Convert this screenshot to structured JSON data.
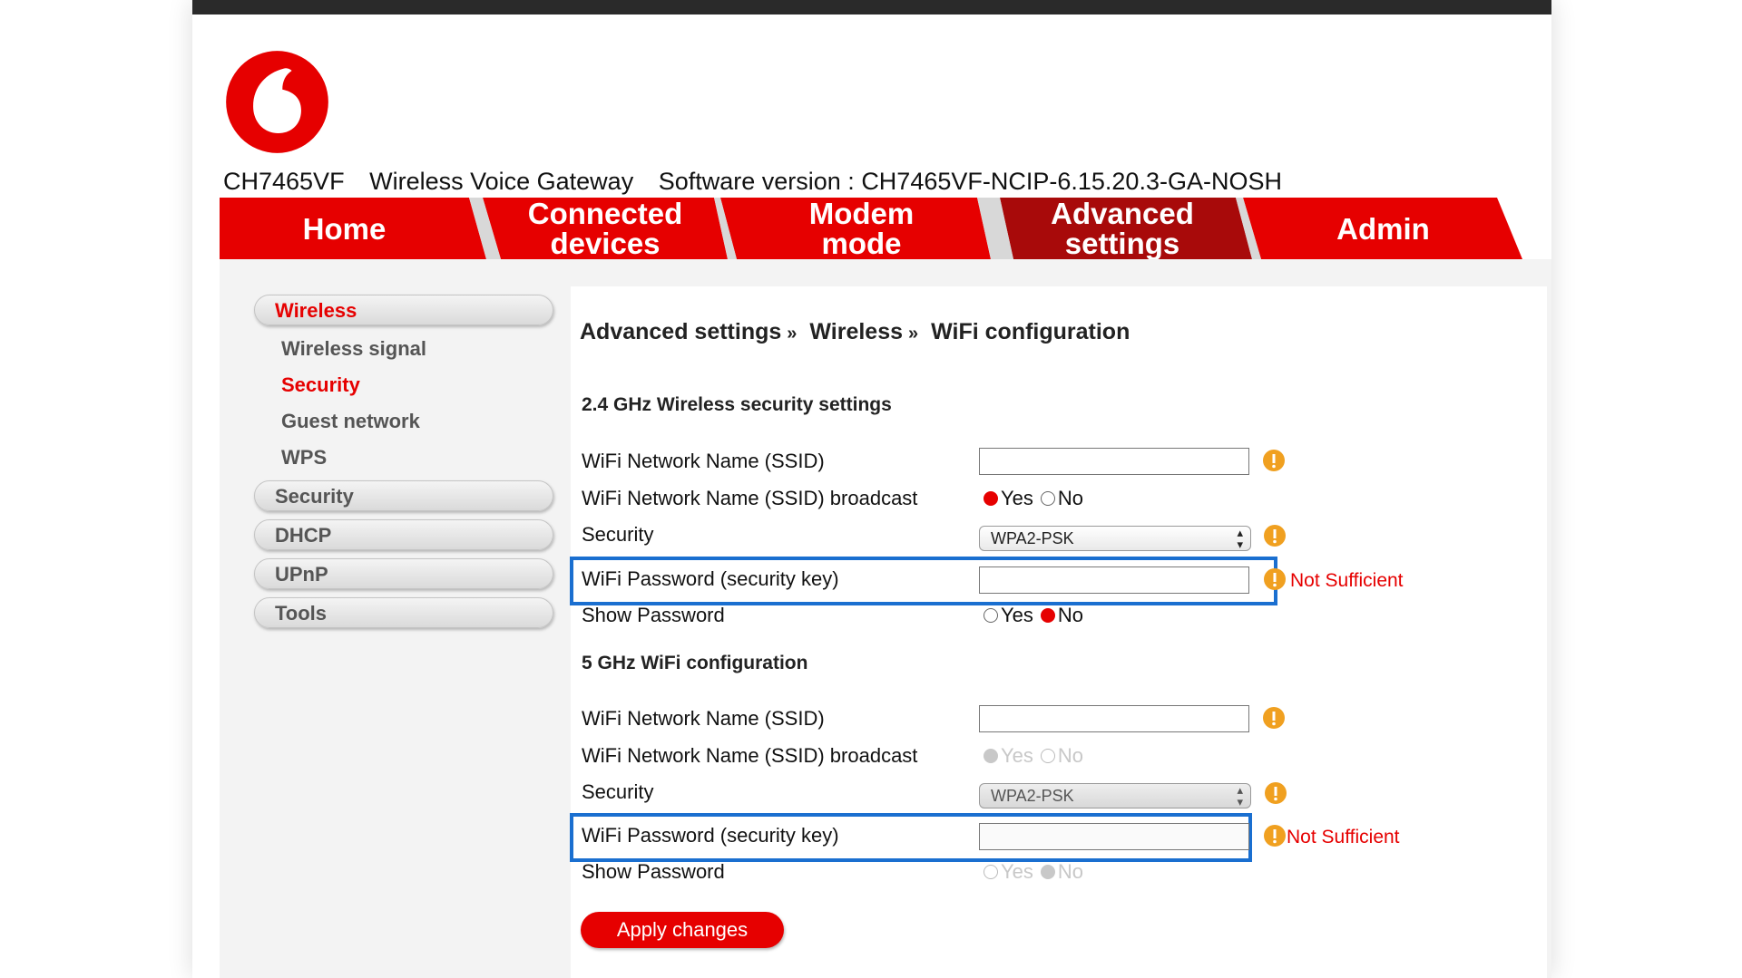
{
  "header": {
    "model": "CH7465VF",
    "device_type": "Wireless Voice Gateway",
    "software_version": "Software version : CH7465VF-NCIP-6.15.20.3-GA-NOSH",
    "logo": "vodafone-logo"
  },
  "nav": {
    "tabs": [
      {
        "line1": "Home",
        "line2": ""
      },
      {
        "line1": "Connected",
        "line2": "devices"
      },
      {
        "line1": "Modem",
        "line2": "mode"
      },
      {
        "line1": "Advanced",
        "line2": "settings"
      },
      {
        "line1": "Admin",
        "line2": ""
      }
    ],
    "active_tab": "Advanced settings"
  },
  "sidebar": {
    "wireless": "Wireless",
    "wireless_sub": [
      "Wireless signal",
      "Security",
      "Guest network",
      "WPS"
    ],
    "security": "Security",
    "dhcp": "DHCP",
    "upnp": "UPnP",
    "tools": "Tools"
  },
  "breadcrumb": {
    "level1": "Advanced settings",
    "level2": "Wireless",
    "level3": "WiFi configuration",
    "separator": "»"
  },
  "band24": {
    "title": "2.4 GHz Wireless security settings",
    "ssid_label": "WiFi Network Name (SSID)",
    "ssid_value": "",
    "broadcast_label": "WiFi Network Name (SSID) broadcast",
    "broadcast_selected": "Yes",
    "security_label": "Security",
    "security_value": "WPA2-PSK",
    "password_label": "WiFi Password (security key)",
    "password_value": "",
    "password_status": "Not Sufficient",
    "show_password_label": "Show Password",
    "show_password_selected": "No"
  },
  "band5": {
    "title": "5 GHz WiFi configuration",
    "ssid_label": "WiFi Network Name (SSID)",
    "ssid_value": "",
    "broadcast_label": "WiFi Network Name (SSID) broadcast",
    "broadcast_selected": "Yes",
    "security_label": "Security",
    "security_value": "WPA2-PSK",
    "password_label": "WiFi Password (security key)",
    "password_value": "",
    "password_status": "Not Sufficient",
    "show_password_label": "Show Password",
    "show_password_selected": "No"
  },
  "radio_labels": {
    "yes": "Yes",
    "no": "No"
  },
  "apply_button": "Apply changes",
  "colors": {
    "brand_red": "#e60000",
    "active_tab": "#a80a0a",
    "highlight_blue": "#1a6fd0",
    "warning_orange": "#f0a020"
  }
}
